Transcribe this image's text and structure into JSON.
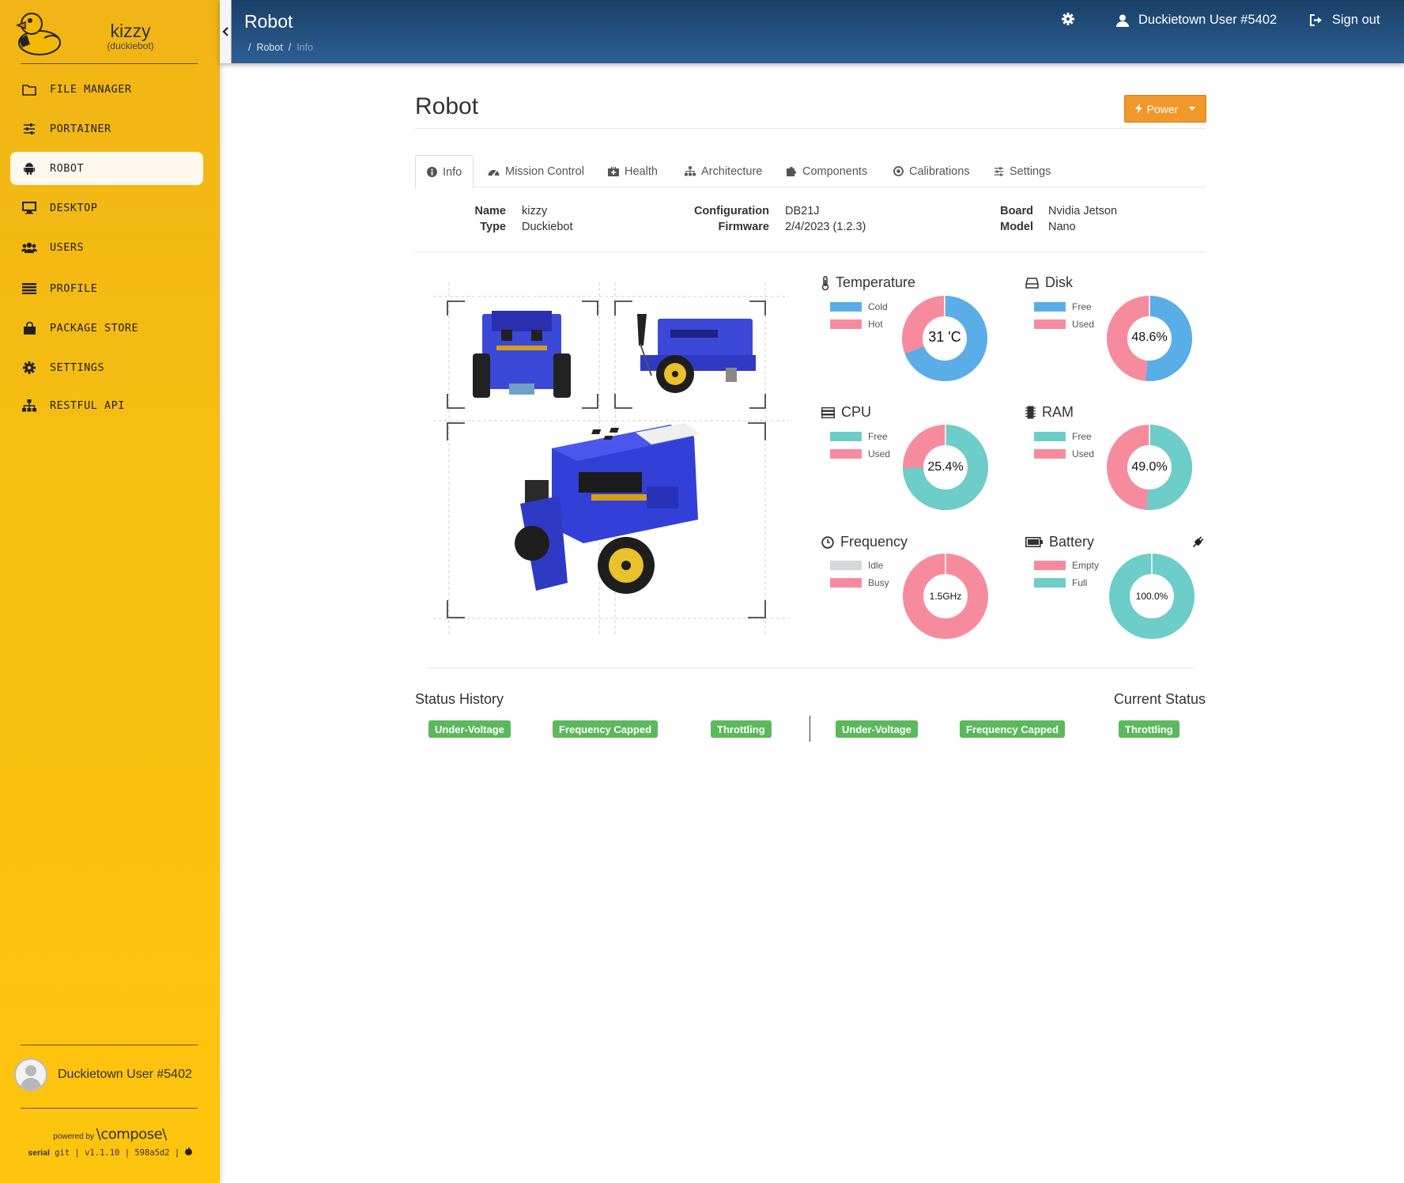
{
  "sidebar": {
    "robot_name": "kizzy",
    "robot_type": "(duckiebot)",
    "items": [
      {
        "label": "FILE MANAGER",
        "icon": "folder-icon"
      },
      {
        "label": "PORTAINER",
        "icon": "sliders-icon"
      },
      {
        "label": "ROBOT",
        "icon": "android-icon",
        "active": true
      },
      {
        "label": "DESKTOP",
        "icon": "monitor-icon"
      },
      {
        "label": "USERS",
        "icon": "users-icon"
      },
      {
        "label": "PROFILE",
        "icon": "list-icon"
      },
      {
        "label": "PACKAGE STORE",
        "icon": "shopping-bag-icon"
      },
      {
        "label": "SETTINGS",
        "icon": "gear-icon"
      },
      {
        "label": "RESTFUL API",
        "icon": "sitemap-icon"
      }
    ],
    "user": "Duckietown User #5402",
    "powered_by": "powered by",
    "compose": "\\compose\\",
    "footer_serial": "serial",
    "footer_git": "git | v1.1.10 | 598a5d2 |"
  },
  "header": {
    "title": "Robot",
    "breadcrumb": [
      "Robot",
      "Info"
    ],
    "user_label": "Duckietown User #5402",
    "signout_label": "Sign out"
  },
  "page": {
    "title": "Robot",
    "power_label": "Power"
  },
  "tabs": [
    "Info",
    "Mission Control",
    "Health",
    "Architecture",
    "Components",
    "Calibrations",
    "Settings"
  ],
  "info": {
    "name_label": "Name",
    "name": "kizzy",
    "type_label": "Type",
    "type": "Duckiebot",
    "config_label": "Configuration",
    "config": "DB21J",
    "firmware_label": "Firmware",
    "firmware": "2/4/2023 (1.2.3)",
    "board_label": "Board",
    "board": "Nvidia Jetson",
    "model_label": "Model",
    "model": "Nano"
  },
  "stats": {
    "temperature": {
      "title": "Temperature",
      "legend": [
        "Cold",
        "Hot"
      ],
      "label": "31 'C",
      "fraction": 0.69,
      "colors": [
        "#5aaee8",
        "#f78b9e"
      ]
    },
    "disk": {
      "title": "Disk",
      "legend": [
        "Free",
        "Used"
      ],
      "label": "48.6%",
      "fraction": 0.514,
      "colors": [
        "#5aaee8",
        "#f78b9e"
      ]
    },
    "cpu": {
      "title": "CPU",
      "legend": [
        "Free",
        "Used"
      ],
      "label": "25.4%",
      "fraction": 0.746,
      "colors": [
        "#6ccdc9",
        "#f78b9e"
      ]
    },
    "ram": {
      "title": "RAM",
      "legend": [
        "Free",
        "Used"
      ],
      "label": "49.0%",
      "fraction": 0.51,
      "colors": [
        "#6ccdc9",
        "#f78b9e"
      ]
    },
    "frequency": {
      "title": "Frequency",
      "legend": [
        "Idle",
        "Busy"
      ],
      "label": "1.5GHz",
      "fraction": 0.0,
      "colors": [
        "#d6d7da",
        "#f78b9e"
      ]
    },
    "battery": {
      "title": "Battery",
      "legend": [
        "Empty",
        "Full"
      ],
      "label": "100.0%",
      "fraction": 0.0,
      "colors": [
        "#f78b9e",
        "#6ccdc9"
      ]
    }
  },
  "status": {
    "history_title": "Status History",
    "current_title": "Current Status",
    "history": [
      "Under-Voltage",
      "Frequency Capped",
      "Throttling"
    ],
    "current": [
      "Under-Voltage",
      "Frequency Capped",
      "Throttling"
    ]
  },
  "colors": {
    "sidebar": "#f6c010",
    "header": "#24507e",
    "accent": "#f0982a",
    "badge": "#5cb85c"
  }
}
